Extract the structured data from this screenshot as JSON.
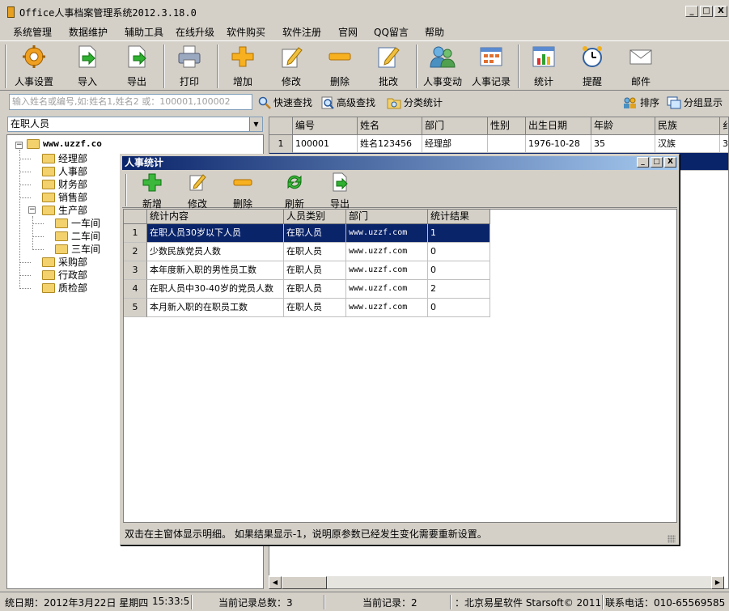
{
  "window": {
    "title": "Office人事档案管理系统2012.3.18.0",
    "buttons": [
      "_",
      "□",
      "X"
    ]
  },
  "menu": [
    "系统管理",
    "数据维护",
    "辅助工具",
    "在线升级",
    "软件购买",
    "软件注册",
    "官网",
    "QQ留言",
    "帮助"
  ],
  "toolbar": [
    {
      "label": "人事设置",
      "icon": "gear-icon"
    },
    {
      "label": "导入",
      "icon": "import-icon"
    },
    {
      "label": "导出",
      "icon": "export-icon"
    },
    {
      "label": "打印",
      "icon": "printer-icon"
    },
    {
      "label": "增加",
      "icon": "plus-icon"
    },
    {
      "label": "修改",
      "icon": "edit-icon"
    },
    {
      "label": "删除",
      "icon": "minus-icon"
    },
    {
      "label": "批改",
      "icon": "batch-edit-icon"
    },
    {
      "label": "人事变动",
      "icon": "people-icon"
    },
    {
      "label": "人事记录",
      "icon": "records-icon"
    },
    {
      "label": "统计",
      "icon": "chart-icon"
    },
    {
      "label": "提醒",
      "icon": "alarm-clock-icon"
    },
    {
      "label": "邮件",
      "icon": "mail-icon"
    }
  ],
  "search": {
    "placeholder": "输入姓名或编号,如:姓名1,姓名2 或：100001,100002",
    "quick": "快速查找",
    "advanced": "高级查找",
    "classify": "分类统计",
    "sort": "排序",
    "group": "分组显示"
  },
  "combo": {
    "value": "在职人员",
    "arrow": "▼"
  },
  "tree": {
    "root": "www.uzzf.co",
    "expand_minus": "−",
    "items": [
      "经理部",
      "人事部",
      "财务部",
      "销售部",
      "生产部",
      "一车间",
      "二车间",
      "三车间",
      "采购部",
      "行政部",
      "质检部"
    ]
  },
  "grid": {
    "headers": [
      "编号",
      "姓名",
      "部门",
      "性别",
      "出生日期",
      "年龄",
      "民族",
      "纟"
    ],
    "rows": [
      {
        "n": "1",
        "cells": [
          "100001",
          "姓名123456",
          "经理部",
          "",
          "1976-10-28",
          "35",
          "汉族",
          "3"
        ]
      }
    ]
  },
  "scroll": {
    "left": "◀",
    "right": "▶"
  },
  "status": {
    "date": "统日期：2012年3月22日 星期四",
    "time": "15:33:5",
    "total": "当前记录总数：3",
    "current": "当前记录：2",
    "company": "：北京易星软件 Starsoft© 2011",
    "phone": "联系电话：010-65569585"
  },
  "dialog": {
    "title": "人事统计",
    "buttons": [
      "_",
      "□",
      "X"
    ],
    "toolbar": [
      {
        "label": "新增",
        "icon": "plus-icon"
      },
      {
        "label": "修改",
        "icon": "edit-icon"
      },
      {
        "label": "删除",
        "icon": "minus-icon"
      },
      {
        "label": "刷新",
        "icon": "refresh-icon"
      },
      {
        "label": "导出",
        "icon": "export-icon"
      }
    ],
    "headers": [
      "统计内容",
      "人员类别",
      "部门",
      "统计结果"
    ],
    "rows": [
      {
        "n": "1",
        "cells": [
          "在职人员30岁以下人员",
          "在职人员",
          "www.uzzf.com",
          "1"
        ]
      },
      {
        "n": "2",
        "cells": [
          "少数民族党员人数",
          "在职人员",
          "www.uzzf.com",
          "0"
        ]
      },
      {
        "n": "3",
        "cells": [
          "本年度新入职的男性员工数",
          "在职人员",
          "www.uzzf.com",
          "0"
        ]
      },
      {
        "n": "4",
        "cells": [
          "在职人员中30-40岁的党员人数",
          "在职人员",
          "www.uzzf.com",
          "2"
        ]
      },
      {
        "n": "5",
        "cells": [
          "本月新入职的在职员工数",
          "在职人员",
          "www.uzzf.com",
          "0"
        ]
      }
    ],
    "status": "双击在主窗体显示明细。 如果结果显示-1，说明原参数已经发生变化需要重新设置。"
  }
}
